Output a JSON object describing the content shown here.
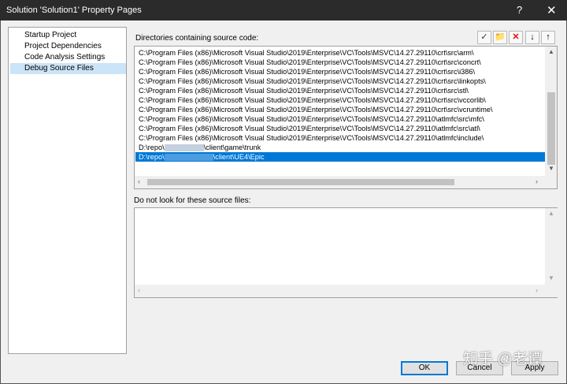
{
  "window": {
    "title": "Solution 'Solution1' Property Pages",
    "help": "?",
    "close": "✕"
  },
  "nav": {
    "items": [
      {
        "label": "Startup Project",
        "selected": false
      },
      {
        "label": "Project Dependencies",
        "selected": false
      },
      {
        "label": "Code Analysis Settings",
        "selected": false
      },
      {
        "label": "Debug Source Files",
        "selected": true
      }
    ]
  },
  "source_dirs": {
    "label": "Directories containing source code:",
    "toolbar": {
      "check": "✓",
      "new_folder": "📁",
      "delete": "✕",
      "down": "↓",
      "up": "↑"
    },
    "rows": [
      "C:\\Program Files (x86)\\Microsoft Visual Studio\\2019\\Enterprise\\VC\\Tools\\MSVC\\14.27.29110\\crt\\src\\arm\\",
      "C:\\Program Files (x86)\\Microsoft Visual Studio\\2019\\Enterprise\\VC\\Tools\\MSVC\\14.27.29110\\crt\\src\\concrt\\",
      "C:\\Program Files (x86)\\Microsoft Visual Studio\\2019\\Enterprise\\VC\\Tools\\MSVC\\14.27.29110\\crt\\src\\i386\\",
      "C:\\Program Files (x86)\\Microsoft Visual Studio\\2019\\Enterprise\\VC\\Tools\\MSVC\\14.27.29110\\crt\\src\\linkopts\\",
      "C:\\Program Files (x86)\\Microsoft Visual Studio\\2019\\Enterprise\\VC\\Tools\\MSVC\\14.27.29110\\crt\\src\\stl\\",
      "C:\\Program Files (x86)\\Microsoft Visual Studio\\2019\\Enterprise\\VC\\Tools\\MSVC\\14.27.29110\\crt\\src\\vccorlib\\",
      "C:\\Program Files (x86)\\Microsoft Visual Studio\\2019\\Enterprise\\VC\\Tools\\MSVC\\14.27.29110\\crt\\src\\vcruntime\\",
      "C:\\Program Files (x86)\\Microsoft Visual Studio\\2019\\Enterprise\\VC\\Tools\\MSVC\\14.27.29110\\atlmfc\\src\\mfc\\",
      "C:\\Program Files (x86)\\Microsoft Visual Studio\\2019\\Enterprise\\VC\\Tools\\MSVC\\14.27.29110\\atlmfc\\src\\atl\\",
      "C:\\Program Files (x86)\\Microsoft Visual Studio\\2019\\Enterprise\\VC\\Tools\\MSVC\\14.27.29110\\atlmfc\\include\\"
    ],
    "redacted_rows": [
      {
        "prefix": "D:\\repo\\",
        "suffix": "\\client\\game\\trunk",
        "selected": false
      },
      {
        "prefix": "D:\\repo\\",
        "suffix": "\\client\\UE4\\Epic",
        "selected": true
      }
    ]
  },
  "exclude": {
    "label": "Do not look for these source files:",
    "value": ""
  },
  "buttons": {
    "ok": "OK",
    "cancel": "Cancel",
    "apply": "Apply"
  },
  "watermark": "知乎 @老谭"
}
